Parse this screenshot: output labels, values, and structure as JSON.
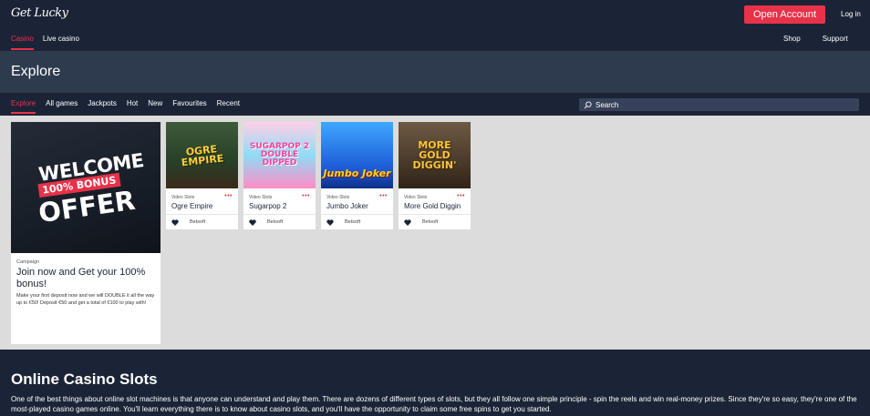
{
  "header": {
    "logo_text": "Get Lucky",
    "open_account_label": "Open Account",
    "login_label": "Log in",
    "main_nav": [
      {
        "label": "Casino",
        "active": true
      },
      {
        "label": "Live casino",
        "active": false
      }
    ],
    "right_nav": [
      {
        "label": "Shop"
      },
      {
        "label": "Support"
      }
    ]
  },
  "page_title": "Explore",
  "sub_nav": [
    {
      "label": "Explore",
      "active": true
    },
    {
      "label": "All games"
    },
    {
      "label": "Jackpots"
    },
    {
      "label": "Hot"
    },
    {
      "label": "New"
    },
    {
      "label": "Favourites"
    },
    {
      "label": "Recent"
    }
  ],
  "search": {
    "placeholder": "Search"
  },
  "promo": {
    "image_text": {
      "line1": "WELCOME",
      "line2": "100% BONUS",
      "line3": "OFFER"
    },
    "tag": "Campaign",
    "title": "Join now and Get your 100% bonus!",
    "text": "Make your first deposit now and we will DOUBLE it all the way up to €50! Deposit €50 and get a total of €100 to play with!"
  },
  "games": [
    {
      "category": "Video Slots",
      "name": "Ogre Empire",
      "provider": "Betsoft",
      "art": "OGRE EMPIRE"
    },
    {
      "category": "Video Slots",
      "name": "Sugarpop 2",
      "provider": "Betsoft",
      "art": "SUGARPOP 2 DOUBLE DIPPED"
    },
    {
      "category": "Video Slots",
      "name": "Jumbo Joker",
      "provider": "Betsoft",
      "art": "Jumbo Joker"
    },
    {
      "category": "Video Slots",
      "name": "More Gold Diggin",
      "provider": "Betsoft",
      "art": "MORE GOLD DIGGIN'"
    }
  ],
  "seo": {
    "heading": "Online Casino Slots",
    "body": "One of the best things about online slot machines is that anyone can understand and play them. There are dozens of different types of slots, but they all follow one simple principle - spin the reels and win real-money prizes. Since they're so easy, they're one of the most-played casino games online. You'll learn everything there is to know about casino slots, and you'll have the opportunity to claim some free spins to get you started."
  },
  "colors": {
    "accent": "#e8324a",
    "navy": "#1b2437",
    "banner": "#2e3a4e",
    "content_bg": "#dcdcdc"
  }
}
